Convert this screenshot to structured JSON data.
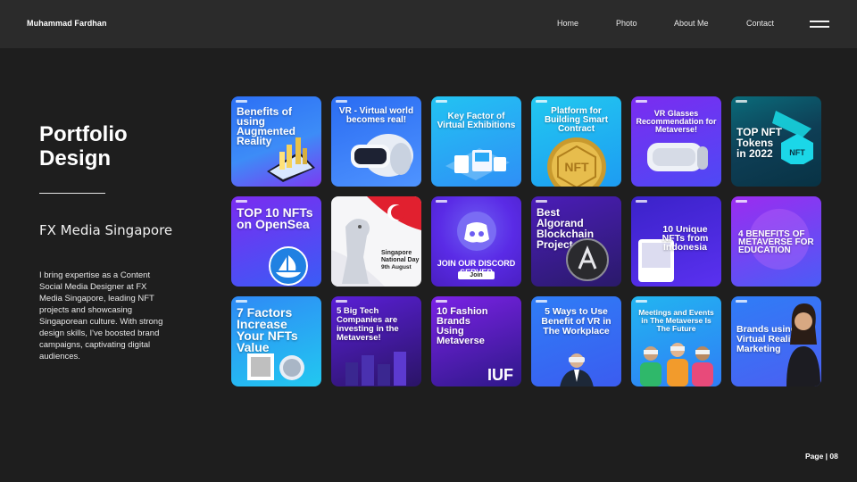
{
  "header": {
    "brand": "Muhammad Fardhan",
    "nav": [
      "Home",
      "Photo",
      "About Me",
      "Contact"
    ]
  },
  "main": {
    "title_line1": "Portfolio",
    "title_line2": "Design",
    "subtitle": "FX Media Singapore",
    "description": "I bring expertise as a Content Social Media Designer at FX Media Singapore, leading NFT projects and showcasing Singaporean culture. With strong design skills, I've boosted brand campaigns, captivating digital audiences."
  },
  "footer": {
    "page": "Page | 08"
  },
  "tiles": [
    {
      "title": "Benefits of using Augmented Reality"
    },
    {
      "title": "VR - Virtual world becomes real!"
    },
    {
      "title": "Key Factor of Virtual Exhibitions"
    },
    {
      "title": "Platform for Building Smart Contract",
      "badge": "NFT"
    },
    {
      "title": "VR Glasses Recommendation for Metaverse!"
    },
    {
      "title": "TOP NFT Tokens in 2022",
      "badge": "NFT"
    },
    {
      "title": "TOP 10 NFTs on OpenSea"
    },
    {
      "title": "Singapore National Day",
      "date": "9th August"
    },
    {
      "title": "JOIN OUR DISCORD SERVER",
      "button": "Join",
      "small": "JOIN OUR"
    },
    {
      "title": "Best Algorand Blockchain Project"
    },
    {
      "title": "10 Unique NFTs from Indonesia"
    },
    {
      "title": "4 BENEFITS OF METAVERSE FOR EDUCATION"
    },
    {
      "title": "7 Factors Increase Your NFTs Value"
    },
    {
      "title": "5 Big Tech Companies are investing in the Metaverse!"
    },
    {
      "title": "10 Fashion Brands Using Metaverse",
      "tag": "IUF"
    },
    {
      "title": "5 Ways to Use Benefit of VR in The Workplace"
    },
    {
      "title": "Meetings and Events in The Metaverse Is The Future"
    },
    {
      "title": "Brands using Virtual Reality Marketing"
    }
  ],
  "colors": {
    "background": "#1e1e1e",
    "topbar": "#2b2b2b",
    "accent_blue": "#2f7df6",
    "accent_purple": "#7a2cf0",
    "accent_cyan": "#1fc8f0"
  }
}
